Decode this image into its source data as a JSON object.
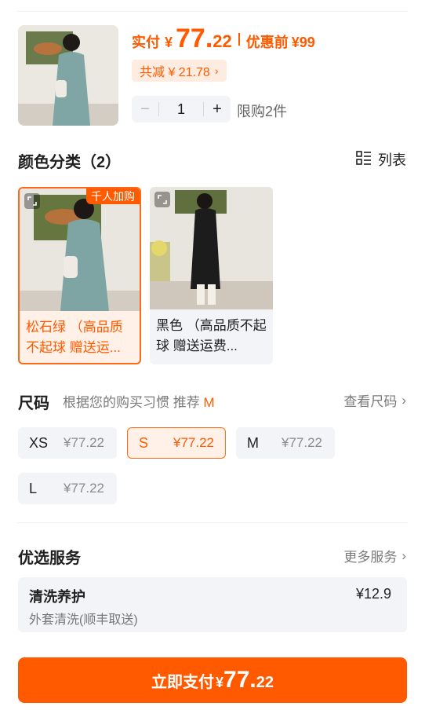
{
  "product": {
    "price_label": "实付",
    "currency": "¥",
    "price_int": "77.",
    "price_dec": "22",
    "before_label": "优惠前",
    "before_price": "¥99",
    "discount_text": "共减 ¥ 21.78",
    "discount_chevron": "›",
    "quantity": "1",
    "minus": "−",
    "plus": "+",
    "limit_text": "限购2件"
  },
  "colors": {
    "title": "颜色分类（2）",
    "view_toggle_label": "列表",
    "items": [
      {
        "name": "松石绿 （高品质不起球 赠送运...",
        "badge": "千人加购",
        "selected": true
      },
      {
        "name": "黑色 （高品质不起球 赠送运费...",
        "badge": "",
        "selected": false
      }
    ]
  },
  "size": {
    "title": "尺码",
    "hint": "根据您的购买习惯 推荐",
    "recommended": "M",
    "view_label": "查看尺码",
    "options": [
      {
        "size": "XS",
        "price": "¥77.22"
      },
      {
        "size": "S",
        "price": "¥77.22"
      },
      {
        "size": "M",
        "price": "¥77.22"
      },
      {
        "size": "L",
        "price": "¥77.22"
      }
    ],
    "selected": "S"
  },
  "service": {
    "title": "优选服务",
    "more_label": "更多服务",
    "item_title": "清洗养护",
    "item_desc": "外套清洗(顺丰取送)",
    "item_price": "¥12.9"
  },
  "pay": {
    "label": "立即支付",
    "currency": "¥",
    "int": "77.",
    "dec": "22"
  },
  "colors_accent": {
    "brand": "#ff5a00",
    "chip_bg": "#f2f4f7"
  }
}
